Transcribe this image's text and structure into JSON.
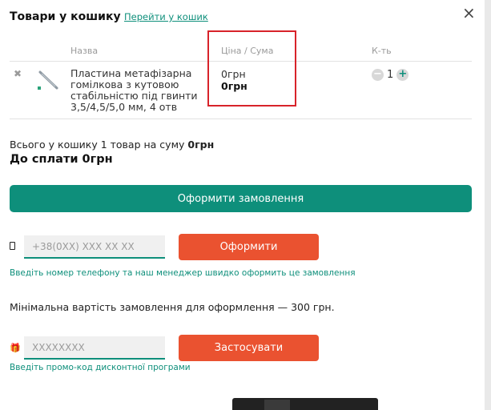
{
  "header": {
    "title": "Товари у кошику",
    "go_to_cart": "Перейти у кошик",
    "close_icon": "close-icon"
  },
  "table": {
    "headers": [
      "Назва",
      "Ціна / Сума",
      "К-ть"
    ]
  },
  "item": {
    "name": "Пластина метафізарна гомілкова з кутовою стабільністю під гвинти 3,5/4,5/5,0 мм, 4 отв",
    "price": "0грн",
    "sum": "0грн",
    "quantity": "1",
    "minus": "−",
    "plus": "+",
    "remove_icon": "✖"
  },
  "summary": {
    "total_prefix": "Всього у кошику 1 товар на суму",
    "total_value": "0грн",
    "to_pay": "До сплати 0грн"
  },
  "checkout_button": "Оформити замовлення",
  "quick_order": {
    "phone_placeholder": "+38(0XX) XXX XX XX",
    "button": "Оформити",
    "hint": "Введіть номер телефону та наш менеджер швидко оформить це замовлення"
  },
  "min_order_text": "Мінімальна вартість замовлення для оформлення — 300 грн.",
  "promo": {
    "placeholder": "XXXXXXXX",
    "button": "Застосувати",
    "hint": "Введіть промо-код дисконтної програми",
    "icon": "gift-icon"
  },
  "colors": {
    "accent": "#0e8f7b",
    "orange": "#ea5230",
    "highlight": "#d8232a"
  }
}
